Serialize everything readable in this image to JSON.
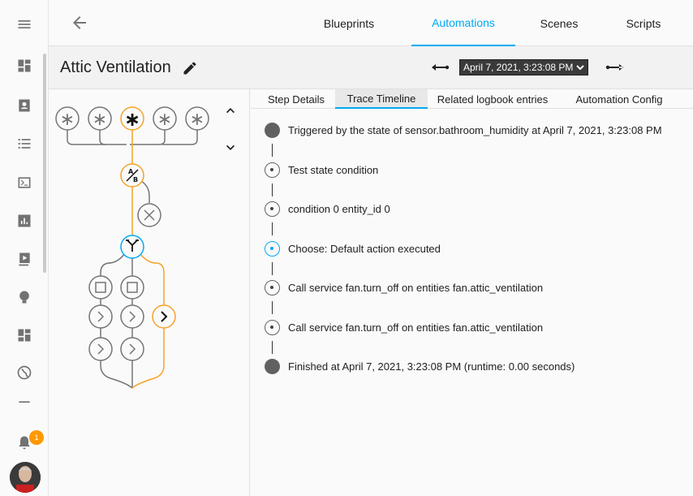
{
  "top_tabs": [
    {
      "label": "Blueprints"
    },
    {
      "label": "Automations"
    },
    {
      "label": "Scenes"
    },
    {
      "label": "Scripts"
    }
  ],
  "header": {
    "title": "Attic Ventilation",
    "trace_selected": "April 7, 2021, 3:23:08 PM"
  },
  "notifications": {
    "count": "1"
  },
  "tabs": [
    {
      "label": "Step Details"
    },
    {
      "label": "Trace Timeline"
    },
    {
      "label": "Related logbook entries"
    },
    {
      "label": "Automation Config"
    }
  ],
  "timeline": [
    {
      "text": "Triggered by the state of sensor.bathroom_humidity at April 7, 2021, 3:23:08 PM",
      "marker": "filled"
    },
    {
      "text": "Test state condition",
      "marker": "ring"
    },
    {
      "text": "condition 0 entity_id 0",
      "marker": "ring"
    },
    {
      "text": "Choose: Default action executed",
      "marker": "ring-blue"
    },
    {
      "text": "Call service fan.turn_off on entities fan.attic_ventilation",
      "marker": "ring"
    },
    {
      "text": "Call service fan.turn_off on entities fan.attic_ventilation",
      "marker": "ring"
    },
    {
      "text": "Finished at April 7, 2021, 3:23:08 PM (runtime: 0.00 seconds)",
      "marker": "filled"
    }
  ],
  "colors": {
    "accent": "#03a9f4",
    "trace_path": "#f6a22a",
    "node": "#757575",
    "badge": "#ff9800"
  },
  "sidebar_icons": [
    "menu-icon",
    "overview-icon",
    "energy-icon",
    "list-icon",
    "terminal-icon",
    "history-icon",
    "media-icon",
    "config-icon",
    "dashboard-icon",
    "globe-icon",
    "divider-icon",
    "bell-icon"
  ]
}
